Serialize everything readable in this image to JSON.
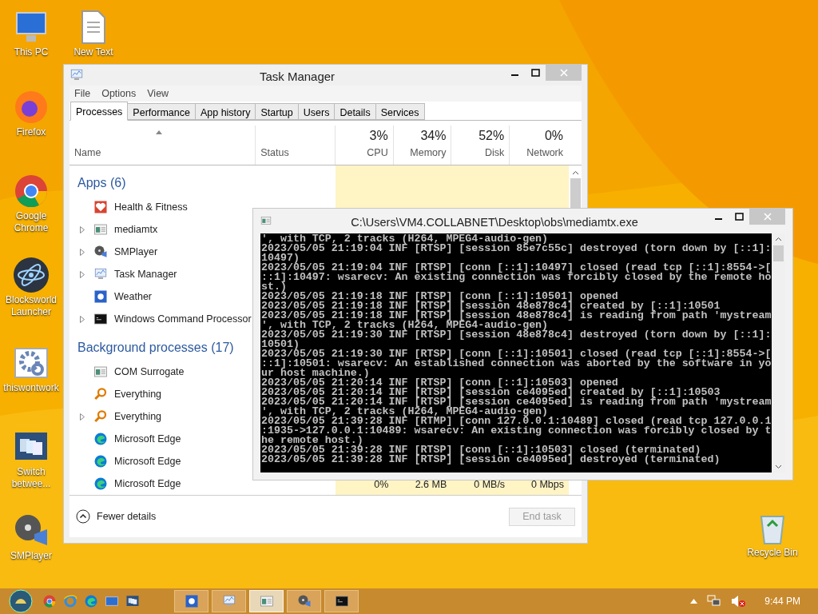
{
  "desktop_icons": [
    {
      "label": "This PC",
      "kind": "pc"
    },
    {
      "label": "New Text",
      "kind": "text"
    },
    {
      "label": "Firefox",
      "kind": "firefox"
    },
    {
      "label": "Google Chrome",
      "kind": "chrome"
    },
    {
      "label": "Blocksworld Launcher",
      "kind": "atom"
    },
    {
      "label": "thiswontwork",
      "kind": "gear"
    },
    {
      "label": "Switch betwee...",
      "kind": "switch"
    },
    {
      "label": "SMPlayer",
      "kind": "smplayer"
    },
    {
      "label": "Recycle Bin",
      "kind": "bin"
    }
  ],
  "task_manager": {
    "title": "Task Manager",
    "menu": [
      "File",
      "Options",
      "View"
    ],
    "tabs": [
      {
        "label": "Processes",
        "selected": true
      },
      {
        "label": "Performance",
        "selected": false
      },
      {
        "label": "App history",
        "selected": false
      },
      {
        "label": "Startup",
        "selected": false
      },
      {
        "label": "Users",
        "selected": false
      },
      {
        "label": "Details",
        "selected": false
      },
      {
        "label": "Services",
        "selected": false
      }
    ],
    "columns": [
      {
        "label": "Name",
        "sorted": true
      },
      {
        "label": "Status"
      },
      {
        "label": "CPU",
        "total": "3%"
      },
      {
        "label": "Memory",
        "total": "34%"
      },
      {
        "label": "Disk",
        "total": "52%"
      },
      {
        "label": "Network",
        "total": "0%"
      }
    ],
    "groups": [
      {
        "title": "Apps (6)",
        "rows": [
          {
            "name": "Health & Fitness",
            "kind": "health",
            "expandable": false
          },
          {
            "name": "mediamtx",
            "kind": "window",
            "expandable": true
          },
          {
            "name": "SMPlayer",
            "kind": "smplayer",
            "expandable": true
          },
          {
            "name": "Task Manager",
            "kind": "taskmgr",
            "expandable": true
          },
          {
            "name": "Weather",
            "kind": "weather",
            "expandable": false
          },
          {
            "name": "Windows Command Processor",
            "kind": "cmd",
            "expandable": true
          }
        ]
      },
      {
        "title": "Background processes (17)",
        "rows": [
          {
            "name": "COM Surrogate",
            "kind": "window",
            "expandable": false
          },
          {
            "name": "Everything",
            "kind": "search",
            "expandable": false
          },
          {
            "name": "Everything",
            "kind": "search",
            "expandable": true
          },
          {
            "name": "Microsoft Edge",
            "kind": "edge",
            "expandable": false
          },
          {
            "name": "Microsoft Edge",
            "kind": "edge",
            "expandable": false
          },
          {
            "name": "Microsoft Edge",
            "kind": "edge",
            "expandable": false,
            "values": [
              "0%",
              "2.6 MB",
              "0 MB/s",
              "0 Mbps"
            ]
          }
        ]
      }
    ],
    "fewer_details": "Fewer details",
    "end_task": {
      "label": "End task",
      "disabled": true
    }
  },
  "console": {
    "title": "C:\\Users\\VM4.COLLABNET\\Desktop\\obs\\mediamtx.exe",
    "lines": [
      "', with TCP, 2 tracks (H264, MPEG4-audio-gen)",
      "2023/05/05 21:19:04 INF [RTSP] [session 85e7c55c] destroyed (torn down by [::1]:",
      "10497)",
      "2023/05/05 21:19:04 INF [RTSP] [conn [::1]:10497] closed (read tcp [::1]:8554->[",
      "::1]:10497: wsarecv: An existing connection was forcibly closed by the remote ho",
      "st.)",
      "2023/05/05 21:19:18 INF [RTSP] [conn [::1]:10501] opened",
      "2023/05/05 21:19:18 INF [RTSP] [session 48e878c4] created by [::1]:10501",
      "2023/05/05 21:19:18 INF [RTSP] [session 48e878c4] is reading from path 'mystream",
      "', with TCP, 2 tracks (H264, MPEG4-audio-gen)",
      "2023/05/05 21:19:30 INF [RTSP] [session 48e878c4] destroyed (torn down by [::1]:",
      "10501)",
      "2023/05/05 21:19:30 INF [RTSP] [conn [::1]:10501] closed (read tcp [::1]:8554->[",
      "::1]:10501: wsarecv: An established connection was aborted by the software in yo",
      "ur host machine.)",
      "2023/05/05 21:20:14 INF [RTSP] [conn [::1]:10503] opened",
      "2023/05/05 21:20:14 INF [RTSP] [session ce4095ed] created by [::1]:10503",
      "2023/05/05 21:20:14 INF [RTSP] [session ce4095ed] is reading from path 'mystream",
      "', with TCP, 2 tracks (H264, MPEG4-audio-gen)",
      "2023/05/05 21:39:28 INF [RTMP] [conn 127.0.0.1:10489] closed (read tcp 127.0.0.1",
      ":1935->127.0.0.1:10489: wsarecv: An existing connection was forcibly closed by t",
      "he remote host.)",
      "2023/05/05 21:39:28 INF [RTSP] [conn [::1]:10503] closed (terminated)",
      "2023/05/05 21:39:28 INF [RTSP] [session ce4095ed] destroyed (terminated)"
    ]
  },
  "taskbar": {
    "pinned": [
      {
        "kind": "chrome"
      },
      {
        "kind": "ie"
      },
      {
        "kind": "edge"
      },
      {
        "kind": "desktop"
      },
      {
        "kind": "switch"
      }
    ],
    "tasks": [
      {
        "kind": "weather",
        "selected": false
      },
      {
        "kind": "taskmgr",
        "selected": false
      },
      {
        "kind": "window",
        "selected": true
      },
      {
        "kind": "smplayer",
        "selected": false
      },
      {
        "kind": "cmd",
        "selected": false
      }
    ],
    "clock": "9:44 PM"
  }
}
